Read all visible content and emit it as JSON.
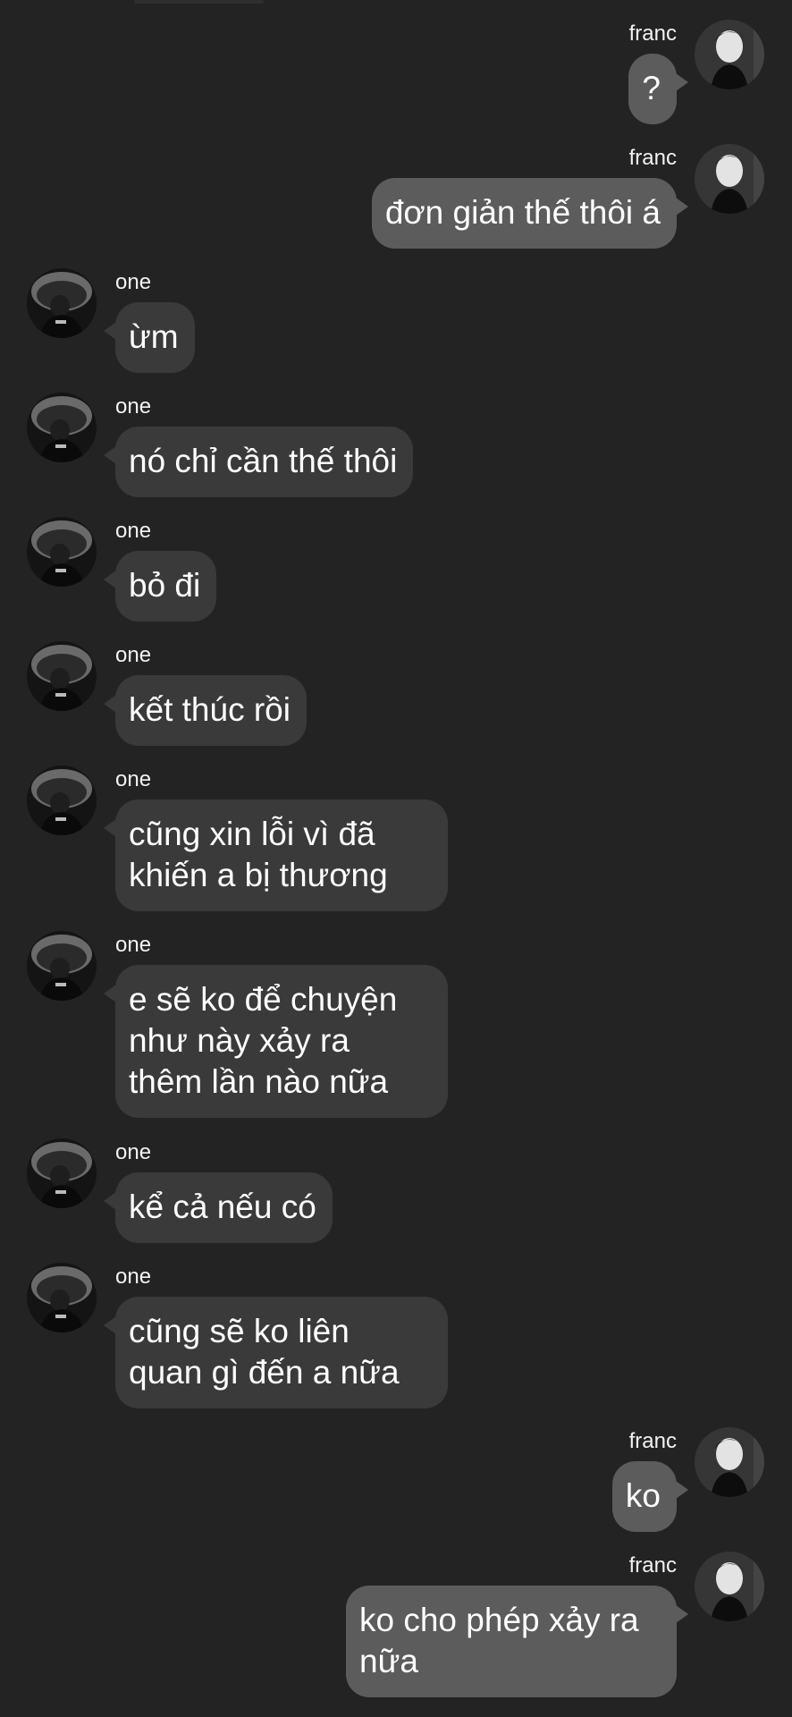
{
  "colors": {
    "background": "#232323",
    "outgoing_bubble": "#5c5c5c",
    "incoming_bubble": "#3a3a3a",
    "text": "#ffffff"
  },
  "messages": [
    {
      "direction": "out",
      "sender": "franc",
      "text": "?",
      "avatar": "franc-avatar"
    },
    {
      "direction": "out",
      "sender": "franc",
      "text": "đơn giản thế thôi á",
      "avatar": "franc-avatar"
    },
    {
      "direction": "in",
      "sender": "one",
      "text": "ừm",
      "avatar": "one-avatar"
    },
    {
      "direction": "in",
      "sender": "one",
      "text": "nó chỉ cần thế thôi",
      "avatar": "one-avatar"
    },
    {
      "direction": "in",
      "sender": "one",
      "text": "bỏ đi",
      "avatar": "one-avatar"
    },
    {
      "direction": "in",
      "sender": "one",
      "text": "kết thúc rồi",
      "avatar": "one-avatar"
    },
    {
      "direction": "in",
      "sender": "one",
      "text": "cũng xin lỗi vì đã khiến a bị thương",
      "avatar": "one-avatar"
    },
    {
      "direction": "in",
      "sender": "one",
      "text": "e sẽ ko để chuyện như này xảy ra thêm lần nào nữa",
      "avatar": "one-avatar"
    },
    {
      "direction": "in",
      "sender": "one",
      "text": "kể cả nếu có",
      "avatar": "one-avatar"
    },
    {
      "direction": "in",
      "sender": "one",
      "text": "cũng sẽ ko liên quan gì đến a nữa",
      "avatar": "one-avatar"
    },
    {
      "direction": "out",
      "sender": "franc",
      "text": "ko",
      "avatar": "franc-avatar"
    },
    {
      "direction": "out",
      "sender": "franc",
      "text": "ko cho phép xảy ra nữa",
      "avatar": "franc-avatar"
    }
  ]
}
